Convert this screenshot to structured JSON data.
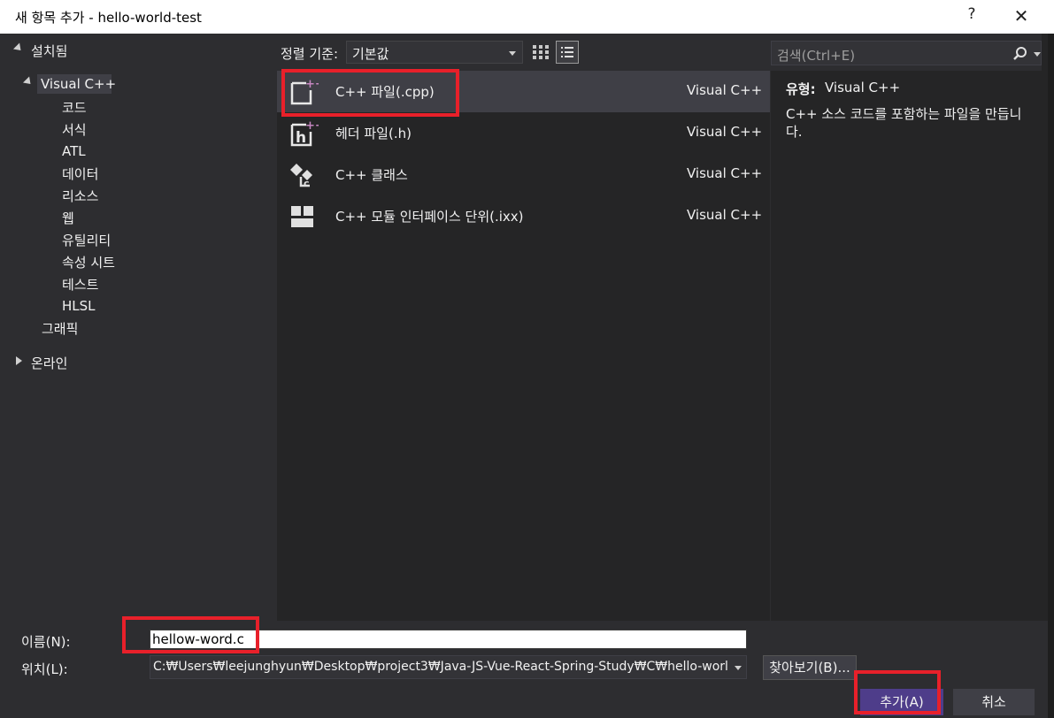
{
  "window": {
    "title": "새 항목 추가 - hello-world-test",
    "help_label": "?",
    "close_label": "✕"
  },
  "tree": {
    "installed": "설치됨",
    "visual_cpp": "Visual C++",
    "children": [
      "코드",
      "서식",
      "ATL",
      "데이터",
      "리소스",
      "웹",
      "유틸리티",
      "속성 시트",
      "테스트",
      "HLSL"
    ],
    "graphics": "그래픽",
    "online": "온라인"
  },
  "toolbar": {
    "sort_label": "정렬 기준:",
    "sort_value": "기본값"
  },
  "search": {
    "placeholder": "검색(Ctrl+E)"
  },
  "templates": [
    {
      "name": "C++ 파일(.cpp)",
      "type": "Visual C++",
      "icon": "cpp-file-icon"
    },
    {
      "name": "헤더 파일(.h)",
      "type": "Visual C++",
      "icon": "header-file-icon"
    },
    {
      "name": "C++ 클래스",
      "type": "Visual C++",
      "icon": "cpp-class-icon"
    },
    {
      "name": "C++ 모듈 인터페이스 단위(.ixx)",
      "type": "Visual C++",
      "icon": "module-interface-icon"
    }
  ],
  "info": {
    "type_label": "유형:",
    "type_value": "Visual C++",
    "description": "C++ 소스 코드를 포함하는 파일을 만듭니다."
  },
  "form": {
    "name_label": "이름(N):",
    "name_value": "hellow-word.c",
    "location_label": "위치(L):",
    "location_value": "C:₩Users₩leejunghyun₩Desktop₩project3₩Java-JS-Vue-React-Spring-Study₩C₩hello-world-test",
    "browse_label": "찾아보기(B)...",
    "add_label": "추가(A)",
    "cancel_label": "취소"
  },
  "colors": {
    "background": "#2d2d30",
    "panel": "#252526",
    "selected": "#3f3f46",
    "primary_button": "#4e3d8a",
    "annotation": "#e8202a"
  }
}
